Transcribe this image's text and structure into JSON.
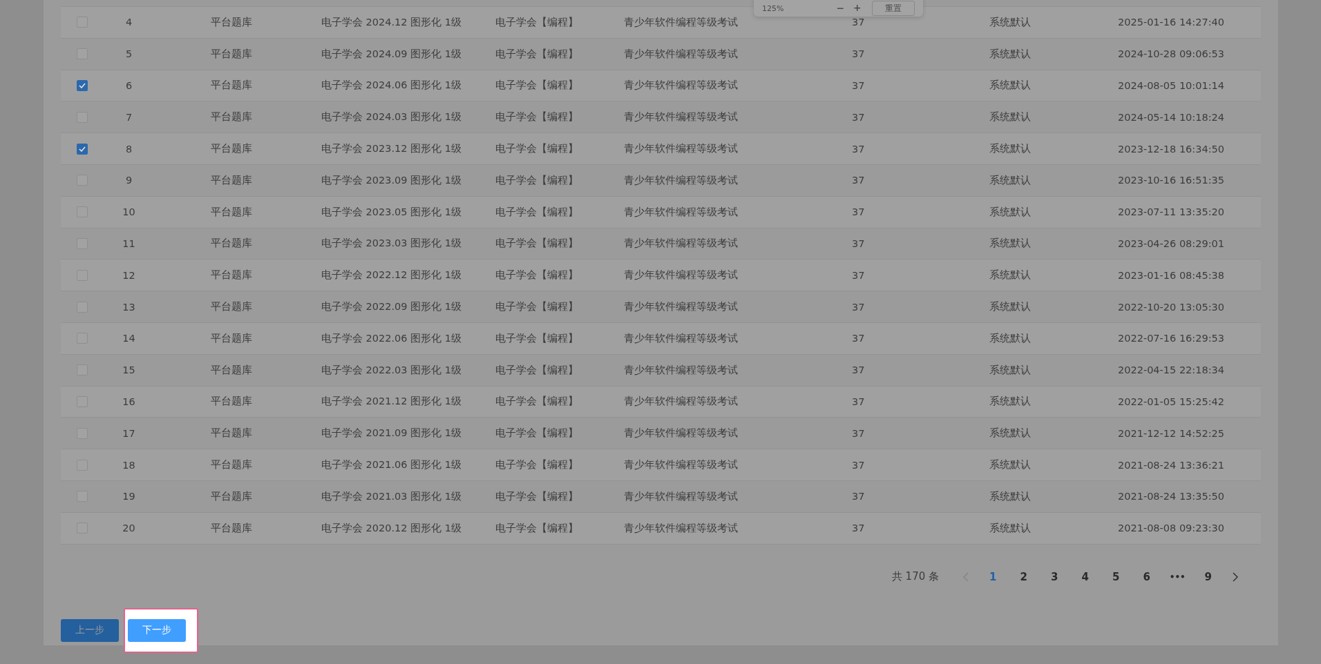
{
  "zoom_popup": {
    "zoom": "125%",
    "minus": "−",
    "plus": "+",
    "reset": "重置"
  },
  "table": {
    "rows": [
      {
        "checked": false,
        "cells": [
          "4",
          "平台题库",
          "电子学会 2024.12 图形化 1级",
          "电子学会【编程】",
          "青少年软件编程等级考试",
          "37",
          "系统默认",
          "2025-01-16 14:27:40"
        ]
      },
      {
        "checked": false,
        "cells": [
          "5",
          "平台题库",
          "电子学会 2024.09 图形化 1级",
          "电子学会【编程】",
          "青少年软件编程等级考试",
          "37",
          "系统默认",
          "2024-10-28 09:06:53"
        ]
      },
      {
        "checked": true,
        "cells": [
          "6",
          "平台题库",
          "电子学会 2024.06 图形化 1级",
          "电子学会【编程】",
          "青少年软件编程等级考试",
          "37",
          "系统默认",
          "2024-08-05 10:01:14"
        ]
      },
      {
        "checked": false,
        "cells": [
          "7",
          "平台题库",
          "电子学会 2024.03 图形化 1级",
          "电子学会【编程】",
          "青少年软件编程等级考试",
          "37",
          "系统默认",
          "2024-05-14 10:18:24"
        ]
      },
      {
        "checked": true,
        "cells": [
          "8",
          "平台题库",
          "电子学会 2023.12 图形化 1级",
          "电子学会【编程】",
          "青少年软件编程等级考试",
          "37",
          "系统默认",
          "2023-12-18 16:34:50"
        ]
      },
      {
        "checked": false,
        "cells": [
          "9",
          "平台题库",
          "电子学会 2023.09 图形化 1级",
          "电子学会【编程】",
          "青少年软件编程等级考试",
          "37",
          "系统默认",
          "2023-10-16 16:51:35"
        ]
      },
      {
        "checked": false,
        "cells": [
          "10",
          "平台题库",
          "电子学会 2023.05 图形化 1级",
          "电子学会【编程】",
          "青少年软件编程等级考试",
          "37",
          "系统默认",
          "2023-07-11 13:35:20"
        ]
      },
      {
        "checked": false,
        "cells": [
          "11",
          "平台题库",
          "电子学会 2023.03 图形化 1级",
          "电子学会【编程】",
          "青少年软件编程等级考试",
          "37",
          "系统默认",
          "2023-04-26 08:29:01"
        ]
      },
      {
        "checked": false,
        "cells": [
          "12",
          "平台题库",
          "电子学会 2022.12 图形化 1级",
          "电子学会【编程】",
          "青少年软件编程等级考试",
          "37",
          "系统默认",
          "2023-01-16 08:45:38"
        ]
      },
      {
        "checked": false,
        "cells": [
          "13",
          "平台题库",
          "电子学会 2022.09 图形化 1级",
          "电子学会【编程】",
          "青少年软件编程等级考试",
          "37",
          "系统默认",
          "2022-10-20 13:05:30"
        ]
      },
      {
        "checked": false,
        "cells": [
          "14",
          "平台题库",
          "电子学会 2022.06 图形化 1级",
          "电子学会【编程】",
          "青少年软件编程等级考试",
          "37",
          "系统默认",
          "2022-07-16 16:29:53"
        ]
      },
      {
        "checked": false,
        "cells": [
          "15",
          "平台题库",
          "电子学会 2022.03 图形化 1级",
          "电子学会【编程】",
          "青少年软件编程等级考试",
          "37",
          "系统默认",
          "2022-04-15 22:18:34"
        ]
      },
      {
        "checked": false,
        "cells": [
          "16",
          "平台题库",
          "电子学会 2021.12 图形化 1级",
          "电子学会【编程】",
          "青少年软件编程等级考试",
          "37",
          "系统默认",
          "2022-01-05 15:25:42"
        ]
      },
      {
        "checked": false,
        "cells": [
          "17",
          "平台题库",
          "电子学会 2021.09 图形化 1级",
          "电子学会【编程】",
          "青少年软件编程等级考试",
          "37",
          "系统默认",
          "2021-12-12 14:52:25"
        ]
      },
      {
        "checked": false,
        "cells": [
          "18",
          "平台题库",
          "电子学会 2021.06 图形化 1级",
          "电子学会【编程】",
          "青少年软件编程等级考试",
          "37",
          "系统默认",
          "2021-08-24 13:36:21"
        ]
      },
      {
        "checked": false,
        "cells": [
          "19",
          "平台题库",
          "电子学会 2021.03 图形化 1级",
          "电子学会【编程】",
          "青少年软件编程等级考试",
          "37",
          "系统默认",
          "2021-08-24 13:35:50"
        ]
      },
      {
        "checked": false,
        "cells": [
          "20",
          "平台题库",
          "电子学会 2020.12 图形化 1级",
          "电子学会【编程】",
          "青少年软件编程等级考试",
          "37",
          "系统默认",
          "2021-08-08 09:23:30"
        ]
      }
    ]
  },
  "pagination": {
    "total": "共 170 条",
    "prev": {
      "disabled": true
    },
    "next": {
      "disabled": false
    },
    "pages": [
      {
        "label": "1",
        "kind": "page",
        "selected": true
      },
      {
        "label": "2",
        "kind": "page",
        "selected": false
      },
      {
        "label": "3",
        "kind": "page",
        "selected": false
      },
      {
        "label": "4",
        "kind": "page",
        "selected": false
      },
      {
        "label": "5",
        "kind": "page",
        "selected": false
      },
      {
        "label": "6",
        "kind": "page",
        "selected": false
      },
      {
        "label": "•••",
        "kind": "ellipsis",
        "selected": false
      },
      {
        "label": "9",
        "kind": "page",
        "selected": false
      }
    ]
  },
  "buttons": [
    {
      "label": "上一步",
      "highlighted": false
    },
    {
      "label": "下一步",
      "highlighted": true
    }
  ]
}
